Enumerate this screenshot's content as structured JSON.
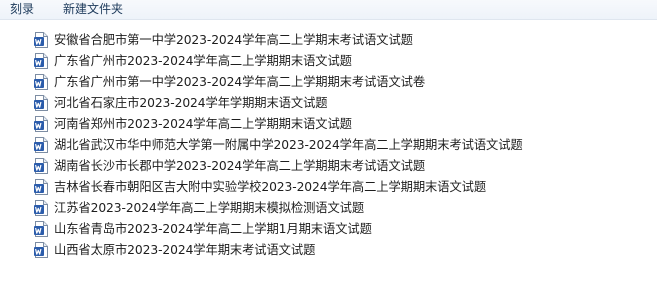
{
  "toolbar": {
    "burn_label": "刻录",
    "new_folder_label": "新建文件夹"
  },
  "files": [
    {
      "name": "安徽省合肥市第一中学2023-2024学年高二上学期末考试语文试题",
      "icon": "word-doc-icon"
    },
    {
      "name": "广东省广州市2023-2024学年高二上学期期末语文试题",
      "icon": "word-doc-icon"
    },
    {
      "name": "广东省广州市第一中学2023-2024学年高二上学期期末考试语文试卷",
      "icon": "word-doc-icon"
    },
    {
      "name": "河北省石家庄市2023-2024学年学期期末语文试题",
      "icon": "word-doc-icon"
    },
    {
      "name": "河南省郑州市2023-2024学年高二上学期期末语文试题",
      "icon": "word-doc-icon"
    },
    {
      "name": "湖北省武汉市华中师范大学第一附属中学2023-2024学年高二上学期期末考试语文试题",
      "icon": "word-doc-icon"
    },
    {
      "name": "湖南省长沙市长郡中学2023-2024学年高二上学期期末考试语文试题",
      "icon": "word-doc-icon"
    },
    {
      "name": "吉林省长春市朝阳区吉大附中实验学校2023-2024学年高二上学期期末语文试题",
      "icon": "word-doc-icon"
    },
    {
      "name": "江苏省2023-2024学年高二上学期期末模拟检测语文试题",
      "icon": "word-doc-icon"
    },
    {
      "name": "山东省青岛市2023-2024学年高二上学期1月期末语文试题",
      "icon": "word-doc-icon"
    },
    {
      "name": "山西省太原市2023-2024学年期末考试语文试题",
      "icon": "word-doc-icon"
    }
  ]
}
